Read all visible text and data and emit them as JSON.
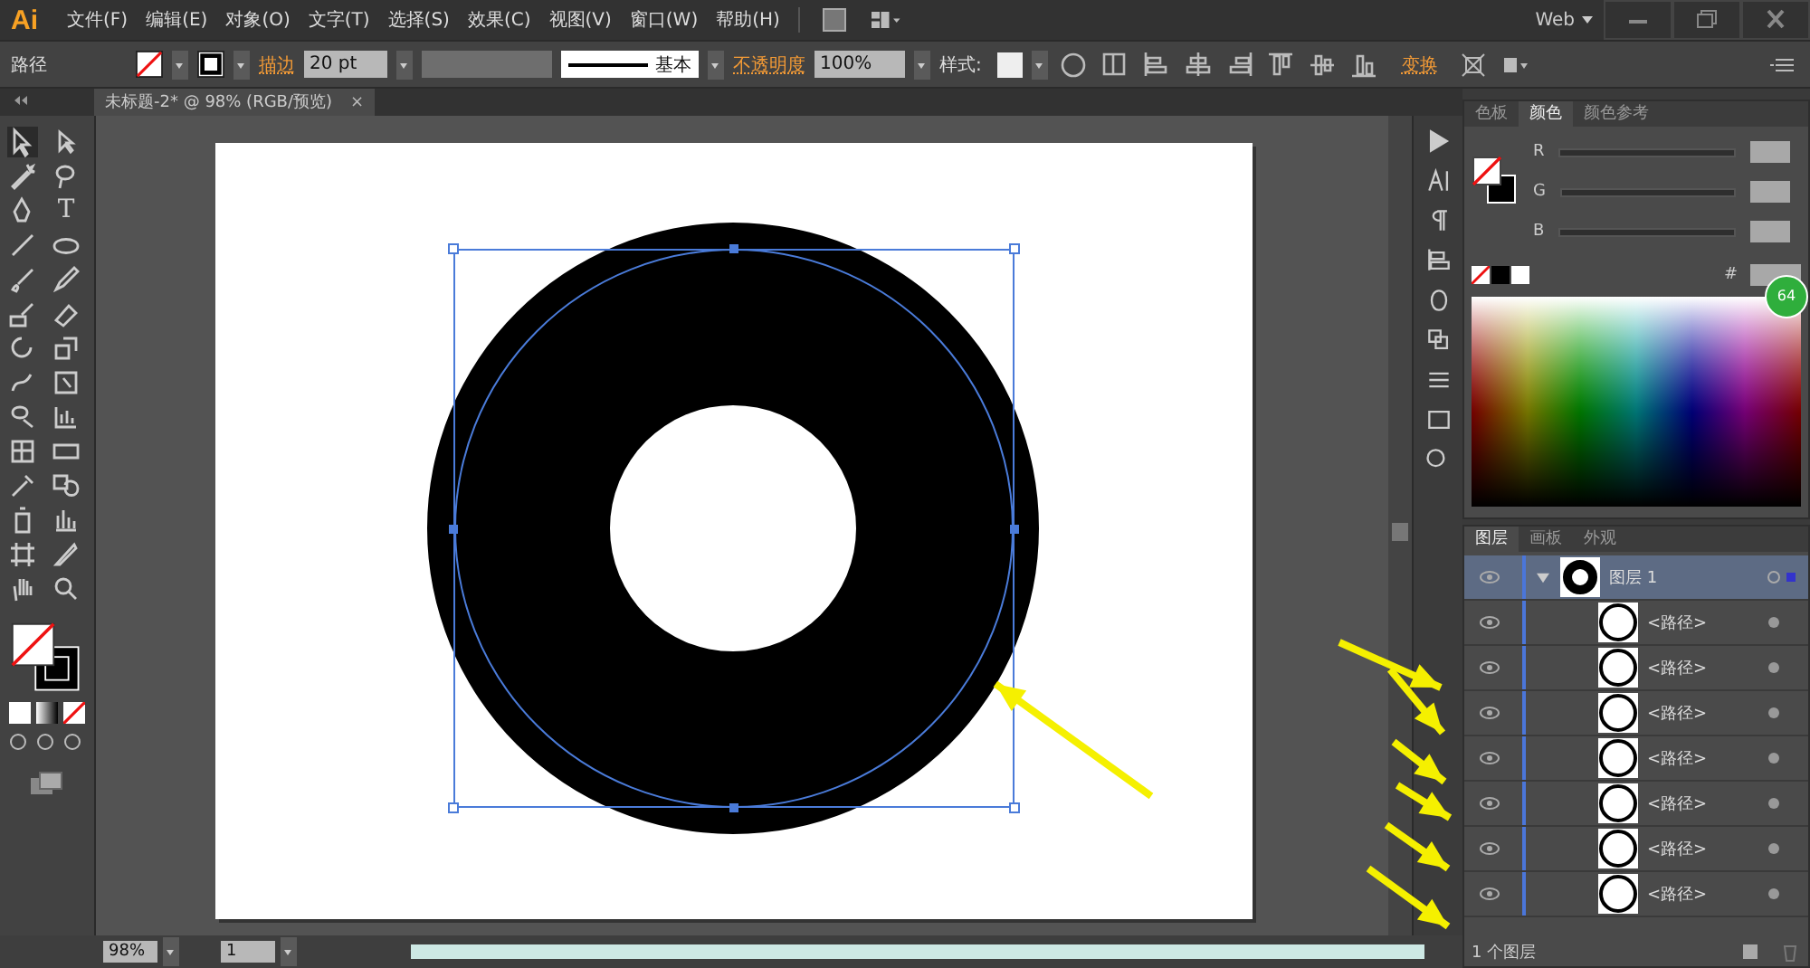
{
  "app_logo": "Ai",
  "menu": [
    "文件(F)",
    "编辑(E)",
    "对象(O)",
    "文字(T)",
    "选择(S)",
    "效果(C)",
    "视图(V)",
    "窗口(W)",
    "帮助(H)"
  ],
  "workspace": "Web",
  "control_bar": {
    "object_type": "路径",
    "stroke_label": "描边",
    "stroke_weight": "20 pt",
    "stroke_profile": "基本",
    "opacity_label": "不透明度",
    "opacity": "100%",
    "style_label": "样式:",
    "transform_label": "变换"
  },
  "document_tab": {
    "title": "未标题-2* @ 98% (RGB/预览)",
    "close": "×"
  },
  "tools": {
    "type_glyph": "T"
  },
  "color_panel": {
    "tabs": [
      {
        "label": "色板",
        "selected": false
      },
      {
        "label": "颜色",
        "selected": true
      },
      {
        "label": "颜色参考",
        "selected": false
      }
    ],
    "channels": [
      "R",
      "G",
      "B"
    ],
    "hex_label": "#"
  },
  "badge": "64",
  "layers_panel": {
    "tabs": [
      {
        "label": "图层",
        "selected": true
      },
      {
        "label": "画板",
        "selected": false
      },
      {
        "label": "外观",
        "selected": false
      }
    ],
    "layers": [
      {
        "name": "图层 1",
        "expanded": true,
        "selected": true,
        "children": [
          {
            "name": "<路径>",
            "selected": false
          },
          {
            "name": "<路径>",
            "selected": false
          },
          {
            "name": "<路径>",
            "selected": false
          },
          {
            "name": "<路径>",
            "selected": false
          },
          {
            "name": "<路径>",
            "selected": false
          },
          {
            "name": "<路径>",
            "selected": false
          },
          {
            "name": "<路径>",
            "selected": false
          }
        ]
      }
    ],
    "footer": "1 个图层"
  },
  "status_bar": {
    "zoom": "98%",
    "artboard": "1"
  }
}
